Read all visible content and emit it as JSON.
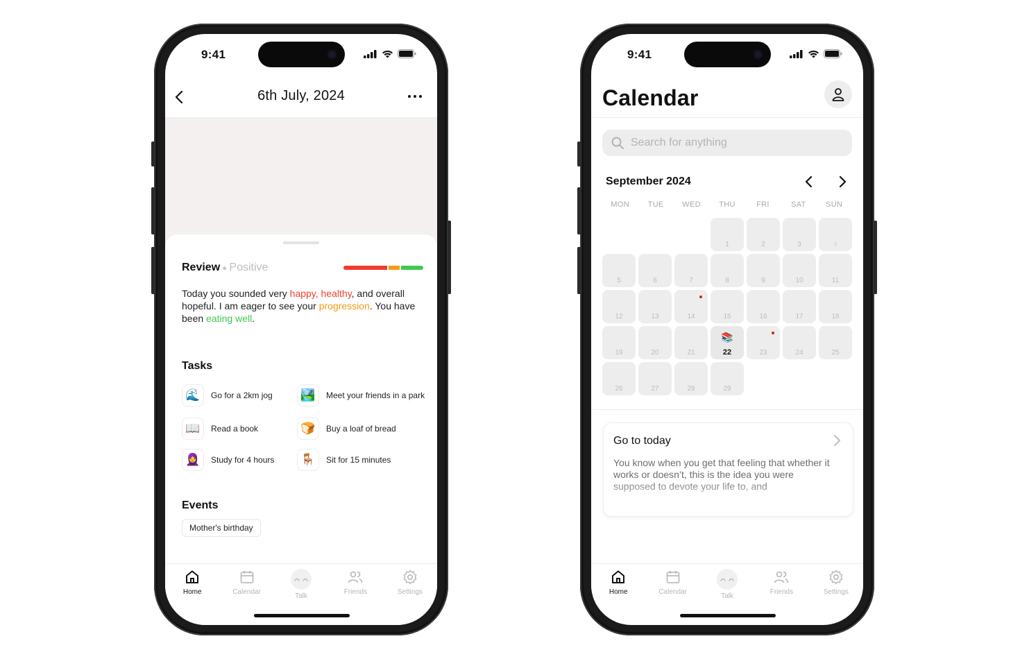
{
  "status": {
    "time": "9:41"
  },
  "tabs": [
    {
      "label": "Home",
      "icon": "home-icon",
      "active": true
    },
    {
      "label": "Calendar",
      "icon": "calendar-icon",
      "active": false
    },
    {
      "label": "Talk",
      "icon": "talk-face-icon",
      "active": false
    },
    {
      "label": "Friends",
      "icon": "friends-icon",
      "active": false
    },
    {
      "label": "Settings",
      "icon": "settings-gear-icon",
      "active": false
    }
  ],
  "day": {
    "title": "6th July, 2024",
    "review": {
      "label": "Review",
      "sentiment": "Positive",
      "bar_colors": [
        "#f03c2e",
        "#f59a19",
        "#3dcb4f"
      ],
      "text": {
        "p1": "Today you sounded very ",
        "w1": "happy,",
        "p2": " ",
        "w2": "healthy",
        "p3": ", and overall hopeful. I am eager to see your ",
        "w3": "progression",
        "p4": ". You have been ",
        "w4": "eating well",
        "p5": "."
      }
    },
    "tasks_label": "Tasks",
    "tasks": [
      {
        "emoji": "🌊",
        "label": "Go for a 2km jog"
      },
      {
        "emoji": "🏞️",
        "label": "Meet your friends in a park"
      },
      {
        "emoji": "📖",
        "label": "Read a book"
      },
      {
        "emoji": "🍞",
        "label": "Buy a loaf of bread"
      },
      {
        "emoji": "🧕",
        "label": "Study for 4 hours"
      },
      {
        "emoji": "🪑",
        "label": "Sit for 15 minutes"
      }
    ],
    "events_label": "Events",
    "events": [
      "Mother's birthday"
    ]
  },
  "calendar": {
    "title": "Calendar",
    "search_placeholder": "Search for anything",
    "month": "September 2024",
    "weekdays": [
      "MON",
      "TUE",
      "WED",
      "THU",
      "FRI",
      "SAT",
      "SUN"
    ],
    "first_weekday_index": 3,
    "days_in_month": 29,
    "today": 22,
    "today_emoji": "📚",
    "marked_days": [
      14,
      23
    ],
    "dim_days": [
      4
    ],
    "go_today": {
      "title": "Go to today",
      "body": "You know when you get that feeling that whether it works or doesn’t, this is the idea you were supposed to devote your life to, and"
    }
  }
}
